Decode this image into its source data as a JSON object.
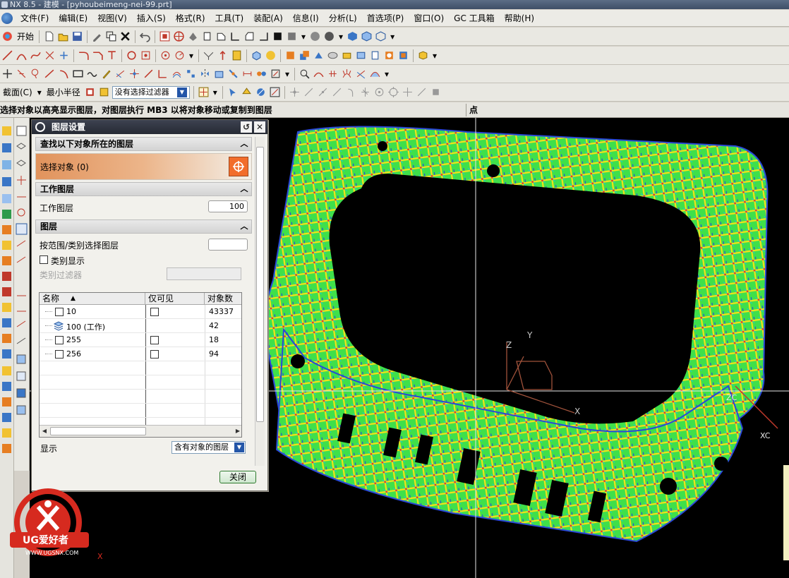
{
  "window": {
    "title": "NX 8.5 - 建模 - [pyhoubeimeng-nei-99.prt]"
  },
  "menu": [
    "文件(F)",
    "编辑(E)",
    "视图(V)",
    "插入(S)",
    "格式(R)",
    "工具(T)",
    "装配(A)",
    "信息(I)",
    "分析(L)",
    "首选项(P)",
    "窗口(O)",
    "GC 工具箱",
    "帮助(H)"
  ],
  "toolbar": {
    "start_label": "开始",
    "section_label": "截面(C)",
    "min_radius_label": "最小半径",
    "filter_value": "没有选择过滤器"
  },
  "status": {
    "message": "选择对象以高亮显示图层，对图层执行 MB3 以将对象移动或复制到图层",
    "right_text": "点"
  },
  "dialog": {
    "title": "图层设置",
    "find_section": "查找以下对象所在的图层",
    "select_object_label": "选择对象 (0)",
    "work_section": "工作图层",
    "work_layer_label": "工作图层",
    "work_layer_value": "100",
    "layers_section": "图层",
    "select_by_range_label": "按范围/类别选择图层",
    "category_display_label": "类别显示",
    "category_filter_label": "类别过滤器",
    "table": {
      "headers": [
        "名称",
        "仅可见",
        "对象数"
      ],
      "rows": [
        {
          "name": "10",
          "visible_only": "",
          "count": "43337"
        },
        {
          "name": "100 (工作)",
          "visible_only": "",
          "count": "42"
        },
        {
          "name": "255",
          "visible_only": "",
          "count": "18"
        },
        {
          "name": "256",
          "visible_only": "",
          "count": "94"
        }
      ]
    },
    "display_label": "显示",
    "display_value": "含有对象的图层",
    "close_label": "关闭"
  },
  "viewport": {
    "background": "#000000",
    "axis_labels": {
      "z": "Z",
      "y": "Y",
      "x": "X",
      "zc": "ZC",
      "xc": "XC"
    }
  },
  "watermark": {
    "text": "UG爱好者",
    "url": "WWW.UGSNX.COM"
  },
  "colors": {
    "accent_orange": "#f26d2b",
    "title_dark": "#262a34",
    "mesh_green": "#3fe04a",
    "mesh_yellow": "#f2e21a",
    "mesh_cyan": "#22c8c8"
  }
}
